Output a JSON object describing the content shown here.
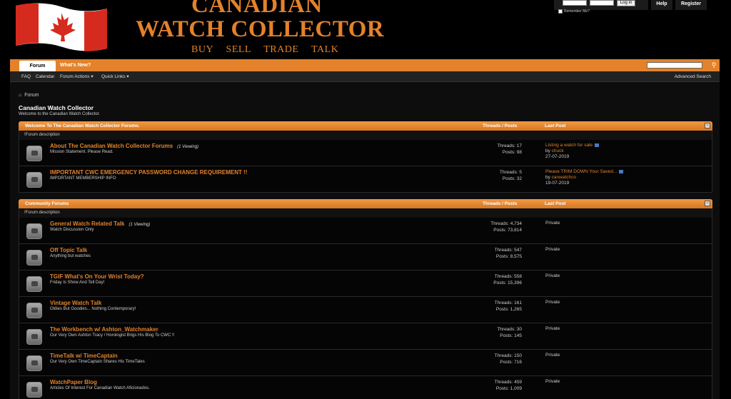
{
  "header": {
    "title_line1": "CANADIAN",
    "title_line2": "WATCH COLLECTOR",
    "tagline": "BUY   SELL   TRADE   TALK",
    "login_button": "Log in",
    "remember_me": "Remember Me?",
    "help": "Help",
    "register": "Register"
  },
  "navbar": {
    "tab_forum": "Forum",
    "tab_whats_new": "What's New?"
  },
  "subnav": {
    "faq": "FAQ",
    "calendar": "Calendar",
    "forum_actions": "Forum Actions ▾",
    "quick_links": "Quick Links ▾",
    "advanced_search": "Advanced Search"
  },
  "breadcrumb": "Forum",
  "page": {
    "title": "Canadian Watch Collector",
    "subtitle": "Welcome to the Canadian Watch Collector."
  },
  "sections": [
    {
      "title": "Welcome To The Canadian Watch Collector Forums.",
      "col_threads_posts": "Threads / Posts",
      "col_last_post": "Last Post",
      "desc": "!Forum description",
      "forums": [
        {
          "title": "About The Canadian Watch Collector Forums",
          "viewing": "(1 Viewing)",
          "sub": "Mission Statement. Please Read.",
          "threads": "Threads: 17",
          "posts": "Posts: 98",
          "last_title": "Listing a watch for sale",
          "last_by": "by ",
          "last_user": "chuck",
          "last_date": "27-07-2019"
        },
        {
          "title": "IMPORTANT CWC EMERGENCY PASSWORD CHANGE REQUIREMENT !!",
          "viewing": "",
          "sub": "IMPORTANT MEMBERSHIP INFO",
          "threads": "Threads: 5",
          "posts": "Posts: 32",
          "last_title": "Please TRIM DOWN Your Saved...",
          "last_by": "by ",
          "last_user": "canwatchco",
          "last_date": "19-07-2019"
        }
      ]
    },
    {
      "title": "Community Forums",
      "col_threads_posts": "Threads / Posts",
      "col_last_post": "Last Post",
      "desc": "!Forum description",
      "forums": [
        {
          "title": "General Watch Related Talk",
          "viewing": "(1 Viewing)",
          "sub": "Watch Discussion Only",
          "threads": "Threads: 4,734",
          "posts": "Posts: 73,814",
          "last": "Private"
        },
        {
          "title": "Off Topic Talk",
          "viewing": "",
          "sub": "Anything but watches",
          "threads": "Threads: 547",
          "posts": "Posts: 8,575",
          "last": "Private"
        },
        {
          "title": "TGIF What's On Your Wrist Today?",
          "viewing": "",
          "sub": "Friday Is Show And Tell Day!",
          "threads": "Threads: 558",
          "posts": "Posts: 15,396",
          "last": "Private"
        },
        {
          "title": "Vintage Watch Talk",
          "viewing": "",
          "sub": "Oldies But Goodies... Nothing Contemporary!",
          "threads": "Threads: 161",
          "posts": "Posts: 1,265",
          "last": "Private"
        },
        {
          "title": "The Workbench w/ Ashton_Watchmaker",
          "viewing": "",
          "sub": "Our Very Own Ashton Tracy / Horologist Brigs His Blog To CWC !!",
          "threads": "Threads: 30",
          "posts": "Posts: 145",
          "last": "Private"
        },
        {
          "title": "TimeTalk w/ TimeCaptain",
          "viewing": "",
          "sub": "Our Very Own TimeCaptain Shares His TimeTales",
          "threads": "Threads: 150",
          "posts": "Posts: 716",
          "last": "Private"
        },
        {
          "title": "WatchPaper Blog",
          "viewing": "",
          "sub": "Articles Of Interest For Canadian Watch Aficionados.",
          "threads": "Threads: 459",
          "posts": "Posts: 1,009",
          "last": "Private"
        }
      ]
    }
  ]
}
